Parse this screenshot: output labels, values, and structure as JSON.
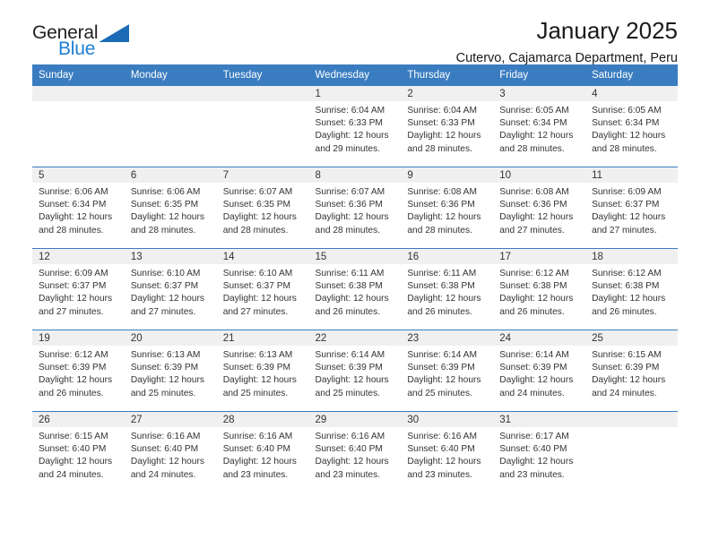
{
  "brand": {
    "name_line1": "General",
    "name_line2": "Blue",
    "triangle_color": "#1b6cb5",
    "blue_color": "#1b7fd4"
  },
  "header": {
    "title": "January 2025",
    "subtitle": "Cutervo, Cajamarca Department, Peru"
  },
  "theme": {
    "header_row_bg": "#3a7cc0",
    "header_row_text": "#ffffff",
    "daynum_bg": "#f0f0f0",
    "row_divider": "#3a7cc0",
    "body_text": "#333333"
  },
  "labels": {
    "sunrise_prefix": "Sunrise:",
    "sunset_prefix": "Sunset:",
    "daylight_prefix": "Daylight:"
  },
  "weekdays": [
    "Sunday",
    "Monday",
    "Tuesday",
    "Wednesday",
    "Thursday",
    "Friday",
    "Saturday"
  ],
  "weeks": [
    [
      {
        "day": "",
        "empty": true
      },
      {
        "day": "",
        "empty": true
      },
      {
        "day": "",
        "empty": true
      },
      {
        "day": "1",
        "sunrise": "Sunrise: 6:04 AM",
        "sunset": "Sunset: 6:33 PM",
        "daylight_l1": "Daylight: 12 hours",
        "daylight_l2": "and 29 minutes."
      },
      {
        "day": "2",
        "sunrise": "Sunrise: 6:04 AM",
        "sunset": "Sunset: 6:33 PM",
        "daylight_l1": "Daylight: 12 hours",
        "daylight_l2": "and 28 minutes."
      },
      {
        "day": "3",
        "sunrise": "Sunrise: 6:05 AM",
        "sunset": "Sunset: 6:34 PM",
        "daylight_l1": "Daylight: 12 hours",
        "daylight_l2": "and 28 minutes."
      },
      {
        "day": "4",
        "sunrise": "Sunrise: 6:05 AM",
        "sunset": "Sunset: 6:34 PM",
        "daylight_l1": "Daylight: 12 hours",
        "daylight_l2": "and 28 minutes."
      }
    ],
    [
      {
        "day": "5",
        "sunrise": "Sunrise: 6:06 AM",
        "sunset": "Sunset: 6:34 PM",
        "daylight_l1": "Daylight: 12 hours",
        "daylight_l2": "and 28 minutes."
      },
      {
        "day": "6",
        "sunrise": "Sunrise: 6:06 AM",
        "sunset": "Sunset: 6:35 PM",
        "daylight_l1": "Daylight: 12 hours",
        "daylight_l2": "and 28 minutes."
      },
      {
        "day": "7",
        "sunrise": "Sunrise: 6:07 AM",
        "sunset": "Sunset: 6:35 PM",
        "daylight_l1": "Daylight: 12 hours",
        "daylight_l2": "and 28 minutes."
      },
      {
        "day": "8",
        "sunrise": "Sunrise: 6:07 AM",
        "sunset": "Sunset: 6:36 PM",
        "daylight_l1": "Daylight: 12 hours",
        "daylight_l2": "and 28 minutes."
      },
      {
        "day": "9",
        "sunrise": "Sunrise: 6:08 AM",
        "sunset": "Sunset: 6:36 PM",
        "daylight_l1": "Daylight: 12 hours",
        "daylight_l2": "and 28 minutes."
      },
      {
        "day": "10",
        "sunrise": "Sunrise: 6:08 AM",
        "sunset": "Sunset: 6:36 PM",
        "daylight_l1": "Daylight: 12 hours",
        "daylight_l2": "and 27 minutes."
      },
      {
        "day": "11",
        "sunrise": "Sunrise: 6:09 AM",
        "sunset": "Sunset: 6:37 PM",
        "daylight_l1": "Daylight: 12 hours",
        "daylight_l2": "and 27 minutes."
      }
    ],
    [
      {
        "day": "12",
        "sunrise": "Sunrise: 6:09 AM",
        "sunset": "Sunset: 6:37 PM",
        "daylight_l1": "Daylight: 12 hours",
        "daylight_l2": "and 27 minutes."
      },
      {
        "day": "13",
        "sunrise": "Sunrise: 6:10 AM",
        "sunset": "Sunset: 6:37 PM",
        "daylight_l1": "Daylight: 12 hours",
        "daylight_l2": "and 27 minutes."
      },
      {
        "day": "14",
        "sunrise": "Sunrise: 6:10 AM",
        "sunset": "Sunset: 6:37 PM",
        "daylight_l1": "Daylight: 12 hours",
        "daylight_l2": "and 27 minutes."
      },
      {
        "day": "15",
        "sunrise": "Sunrise: 6:11 AM",
        "sunset": "Sunset: 6:38 PM",
        "daylight_l1": "Daylight: 12 hours",
        "daylight_l2": "and 26 minutes."
      },
      {
        "day": "16",
        "sunrise": "Sunrise: 6:11 AM",
        "sunset": "Sunset: 6:38 PM",
        "daylight_l1": "Daylight: 12 hours",
        "daylight_l2": "and 26 minutes."
      },
      {
        "day": "17",
        "sunrise": "Sunrise: 6:12 AM",
        "sunset": "Sunset: 6:38 PM",
        "daylight_l1": "Daylight: 12 hours",
        "daylight_l2": "and 26 minutes."
      },
      {
        "day": "18",
        "sunrise": "Sunrise: 6:12 AM",
        "sunset": "Sunset: 6:38 PM",
        "daylight_l1": "Daylight: 12 hours",
        "daylight_l2": "and 26 minutes."
      }
    ],
    [
      {
        "day": "19",
        "sunrise": "Sunrise: 6:12 AM",
        "sunset": "Sunset: 6:39 PM",
        "daylight_l1": "Daylight: 12 hours",
        "daylight_l2": "and 26 minutes."
      },
      {
        "day": "20",
        "sunrise": "Sunrise: 6:13 AM",
        "sunset": "Sunset: 6:39 PM",
        "daylight_l1": "Daylight: 12 hours",
        "daylight_l2": "and 25 minutes."
      },
      {
        "day": "21",
        "sunrise": "Sunrise: 6:13 AM",
        "sunset": "Sunset: 6:39 PM",
        "daylight_l1": "Daylight: 12 hours",
        "daylight_l2": "and 25 minutes."
      },
      {
        "day": "22",
        "sunrise": "Sunrise: 6:14 AM",
        "sunset": "Sunset: 6:39 PM",
        "daylight_l1": "Daylight: 12 hours",
        "daylight_l2": "and 25 minutes."
      },
      {
        "day": "23",
        "sunrise": "Sunrise: 6:14 AM",
        "sunset": "Sunset: 6:39 PM",
        "daylight_l1": "Daylight: 12 hours",
        "daylight_l2": "and 25 minutes."
      },
      {
        "day": "24",
        "sunrise": "Sunrise: 6:14 AM",
        "sunset": "Sunset: 6:39 PM",
        "daylight_l1": "Daylight: 12 hours",
        "daylight_l2": "and 24 minutes."
      },
      {
        "day": "25",
        "sunrise": "Sunrise: 6:15 AM",
        "sunset": "Sunset: 6:39 PM",
        "daylight_l1": "Daylight: 12 hours",
        "daylight_l2": "and 24 minutes."
      }
    ],
    [
      {
        "day": "26",
        "sunrise": "Sunrise: 6:15 AM",
        "sunset": "Sunset: 6:40 PM",
        "daylight_l1": "Daylight: 12 hours",
        "daylight_l2": "and 24 minutes."
      },
      {
        "day": "27",
        "sunrise": "Sunrise: 6:16 AM",
        "sunset": "Sunset: 6:40 PM",
        "daylight_l1": "Daylight: 12 hours",
        "daylight_l2": "and 24 minutes."
      },
      {
        "day": "28",
        "sunrise": "Sunrise: 6:16 AM",
        "sunset": "Sunset: 6:40 PM",
        "daylight_l1": "Daylight: 12 hours",
        "daylight_l2": "and 23 minutes."
      },
      {
        "day": "29",
        "sunrise": "Sunrise: 6:16 AM",
        "sunset": "Sunset: 6:40 PM",
        "daylight_l1": "Daylight: 12 hours",
        "daylight_l2": "and 23 minutes."
      },
      {
        "day": "30",
        "sunrise": "Sunrise: 6:16 AM",
        "sunset": "Sunset: 6:40 PM",
        "daylight_l1": "Daylight: 12 hours",
        "daylight_l2": "and 23 minutes."
      },
      {
        "day": "31",
        "sunrise": "Sunrise: 6:17 AM",
        "sunset": "Sunset: 6:40 PM",
        "daylight_l1": "Daylight: 12 hours",
        "daylight_l2": "and 23 minutes."
      },
      {
        "day": "",
        "empty": true
      }
    ]
  ]
}
